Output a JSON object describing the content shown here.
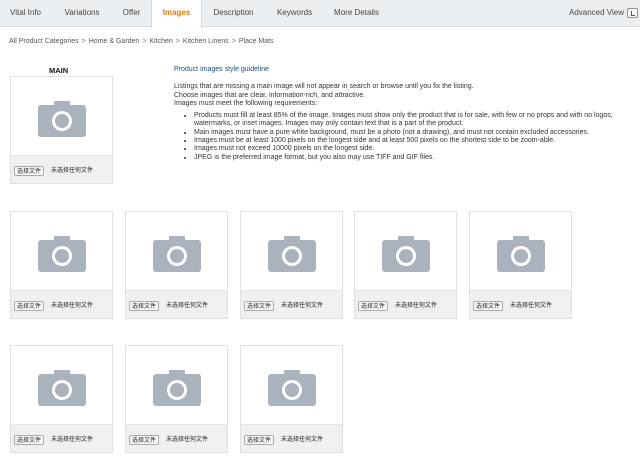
{
  "tabs": [
    {
      "label": "Vital Info",
      "active": false
    },
    {
      "label": "Variations",
      "active": false
    },
    {
      "label": "Offer",
      "active": false
    },
    {
      "label": "Images",
      "active": true
    },
    {
      "label": "Description",
      "active": false
    },
    {
      "label": "Keywords",
      "active": false
    },
    {
      "label": "More Details",
      "active": false
    }
  ],
  "advanced_view": {
    "label": "Advanced View",
    "icon": "checkbox-toggle-icon"
  },
  "breadcrumb": [
    "All Product Categories",
    "Home & Garden",
    "Kitchen",
    "Kitchen Linens",
    "Place Mats"
  ],
  "breadcrumb_separator": ">",
  "main_label": "MAIN",
  "guideline": {
    "title": "Product images style guideline",
    "intro": [
      "Listings that are missing a main image will not appear in search or browse until you fix the listing.",
      "Choose images that are clear, information-rich, and attractive.",
      "Images must meet the following requirements:"
    ],
    "requirements": [
      "Products must fill at least 85% of the image. Images must show only the product that is for sale, with few or no props and with no logos, watermarks, or inset images. Images may only contain text that is a part of the product.",
      "Main images must have a pure white background, must be a photo (not a drawing), and must not contain excluded accessories.",
      "Images must be at least 1000 pixels on the longest side and at least 500 pixels on the shortest side to be zoom-able.",
      "Images must not exceed 10000 pixels on the longest side.",
      "JPEG is the preferred image format, but you also may use TIFF and GIF files."
    ]
  },
  "upload": {
    "button_label": "选择文件",
    "status_label": "未选择任何文件"
  },
  "slots": {
    "main": {
      "icon": "camera-placeholder-icon"
    },
    "row1": [
      {
        "icon": "camera-placeholder-icon"
      },
      {
        "icon": "camera-placeholder-icon"
      },
      {
        "icon": "camera-placeholder-icon"
      },
      {
        "icon": "camera-placeholder-icon"
      },
      {
        "icon": "camera-placeholder-icon"
      }
    ],
    "row2": [
      {
        "icon": "camera-placeholder-icon"
      },
      {
        "icon": "camera-placeholder-icon"
      },
      {
        "icon": "camera-placeholder-icon"
      }
    ]
  },
  "colors": {
    "active_tab": "#e47911",
    "guideline_title": "#1a4b85",
    "placeholder_icon": "#aab2bd"
  }
}
